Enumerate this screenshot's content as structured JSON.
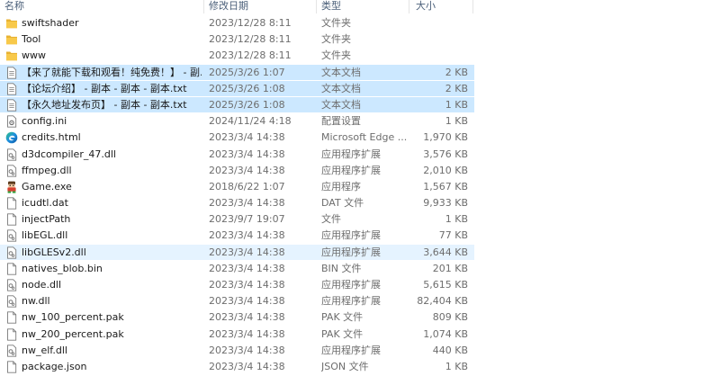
{
  "header": {
    "name": "名称",
    "date": "修改日期",
    "type": "类型",
    "size": "大小"
  },
  "colors": {
    "selected_row": "#cce8ff",
    "hover_row": "#e5f3ff",
    "folder_yellow": "#f8c94a",
    "header_text": "#4c607a"
  },
  "rows": [
    {
      "name": "swiftshader",
      "date": "2023/12/28 8:11",
      "type": "文件夹",
      "size": "",
      "icon": "folder-icon",
      "state": ""
    },
    {
      "name": "Tool",
      "date": "2023/12/28 8:11",
      "type": "文件夹",
      "size": "",
      "icon": "folder-icon",
      "state": ""
    },
    {
      "name": "www",
      "date": "2023/12/28 8:11",
      "type": "文件夹",
      "size": "",
      "icon": "folder-icon",
      "state": ""
    },
    {
      "name": "【来了就能下载和观看！纯免费！】 - 副...",
      "date": "2025/3/26 1:07",
      "type": "文本文档",
      "size": "2 KB",
      "icon": "text-file-icon",
      "state": "selected"
    },
    {
      "name": "【论坛介绍】 - 副本 - 副本 - 副本.txt",
      "date": "2025/3/26 1:08",
      "type": "文本文档",
      "size": "2 KB",
      "icon": "text-file-icon",
      "state": "selected"
    },
    {
      "name": "【永久地址发布页】 - 副本 - 副本.txt",
      "date": "2025/3/26 1:08",
      "type": "文本文档",
      "size": "1 KB",
      "icon": "text-file-icon",
      "state": "selected"
    },
    {
      "name": "config.ini",
      "date": "2024/11/24 4:18",
      "type": "配置设置",
      "size": "1 KB",
      "icon": "config-file-icon",
      "state": ""
    },
    {
      "name": "credits.html",
      "date": "2023/3/4 14:38",
      "type": "Microsoft Edge ...",
      "size": "1,970 KB",
      "icon": "edge-icon",
      "state": ""
    },
    {
      "name": "d3dcompiler_47.dll",
      "date": "2023/3/4 14:38",
      "type": "应用程序扩展",
      "size": "3,576 KB",
      "icon": "dll-file-icon",
      "state": ""
    },
    {
      "name": "ffmpeg.dll",
      "date": "2023/3/4 14:38",
      "type": "应用程序扩展",
      "size": "2,010 KB",
      "icon": "dll-file-icon",
      "state": ""
    },
    {
      "name": "Game.exe",
      "date": "2018/6/22 1:07",
      "type": "应用程序",
      "size": "1,567 KB",
      "icon": "game-exe-icon",
      "state": ""
    },
    {
      "name": "icudtl.dat",
      "date": "2023/3/4 14:38",
      "type": "DAT 文件",
      "size": "9,933 KB",
      "icon": "file-icon",
      "state": ""
    },
    {
      "name": "injectPath",
      "date": "2023/9/7 19:07",
      "type": "文件",
      "size": "1 KB",
      "icon": "file-icon",
      "state": ""
    },
    {
      "name": "libEGL.dll",
      "date": "2023/3/4 14:38",
      "type": "应用程序扩展",
      "size": "77 KB",
      "icon": "dll-file-icon",
      "state": ""
    },
    {
      "name": "libGLESv2.dll",
      "date": "2023/3/4 14:38",
      "type": "应用程序扩展",
      "size": "3,644 KB",
      "icon": "dll-file-icon",
      "state": "hover"
    },
    {
      "name": "natives_blob.bin",
      "date": "2023/3/4 14:38",
      "type": "BIN 文件",
      "size": "201 KB",
      "icon": "file-icon",
      "state": ""
    },
    {
      "name": "node.dll",
      "date": "2023/3/4 14:38",
      "type": "应用程序扩展",
      "size": "5,615 KB",
      "icon": "dll-file-icon",
      "state": ""
    },
    {
      "name": "nw.dll",
      "date": "2023/3/4 14:38",
      "type": "应用程序扩展",
      "size": "82,404 KB",
      "icon": "dll-file-icon",
      "state": ""
    },
    {
      "name": "nw_100_percent.pak",
      "date": "2023/3/4 14:38",
      "type": "PAK 文件",
      "size": "809 KB",
      "icon": "file-icon",
      "state": ""
    },
    {
      "name": "nw_200_percent.pak",
      "date": "2023/3/4 14:38",
      "type": "PAK 文件",
      "size": "1,074 KB",
      "icon": "file-icon",
      "state": ""
    },
    {
      "name": "nw_elf.dll",
      "date": "2023/3/4 14:38",
      "type": "应用程序扩展",
      "size": "440 KB",
      "icon": "dll-file-icon",
      "state": ""
    },
    {
      "name": "package.json",
      "date": "2023/3/4 14:38",
      "type": "JSON 文件",
      "size": "1 KB",
      "icon": "file-icon",
      "state": ""
    }
  ]
}
